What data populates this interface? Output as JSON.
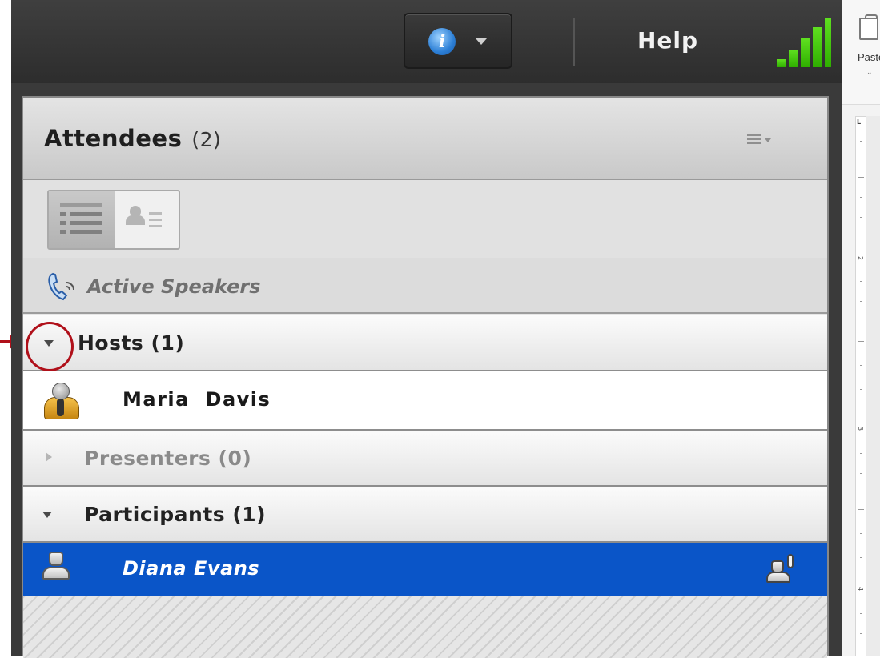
{
  "topbar": {
    "info_glyph": "i",
    "help_label": "Help",
    "signal_icon": "signal-strength-icon",
    "signal_color": "#3cc00c"
  },
  "pod": {
    "title": "Attendees",
    "count": "(2)",
    "active_speakers_label": "Active Speakers",
    "groups": [
      {
        "label": "Hosts (1)",
        "expanded": true,
        "members": [
          {
            "name": "Maria  Davis",
            "role_icon": "host-avatar-icon"
          }
        ]
      },
      {
        "label": "Presenters (0)",
        "expanded": false,
        "members": []
      },
      {
        "label": "Participants (1)",
        "expanded": true,
        "members": [
          {
            "name": "Diana Evans",
            "role_icon": "participant-avatar-icon",
            "status_icon": "raise-hand-icon",
            "selected": true
          }
        ]
      }
    ],
    "selection_color": "#0a55c8"
  },
  "side_app": {
    "paste_label": "Paste",
    "ruler_numbers": [
      "2",
      "3",
      "4"
    ]
  },
  "annotation": {
    "color": "#b0101a"
  }
}
